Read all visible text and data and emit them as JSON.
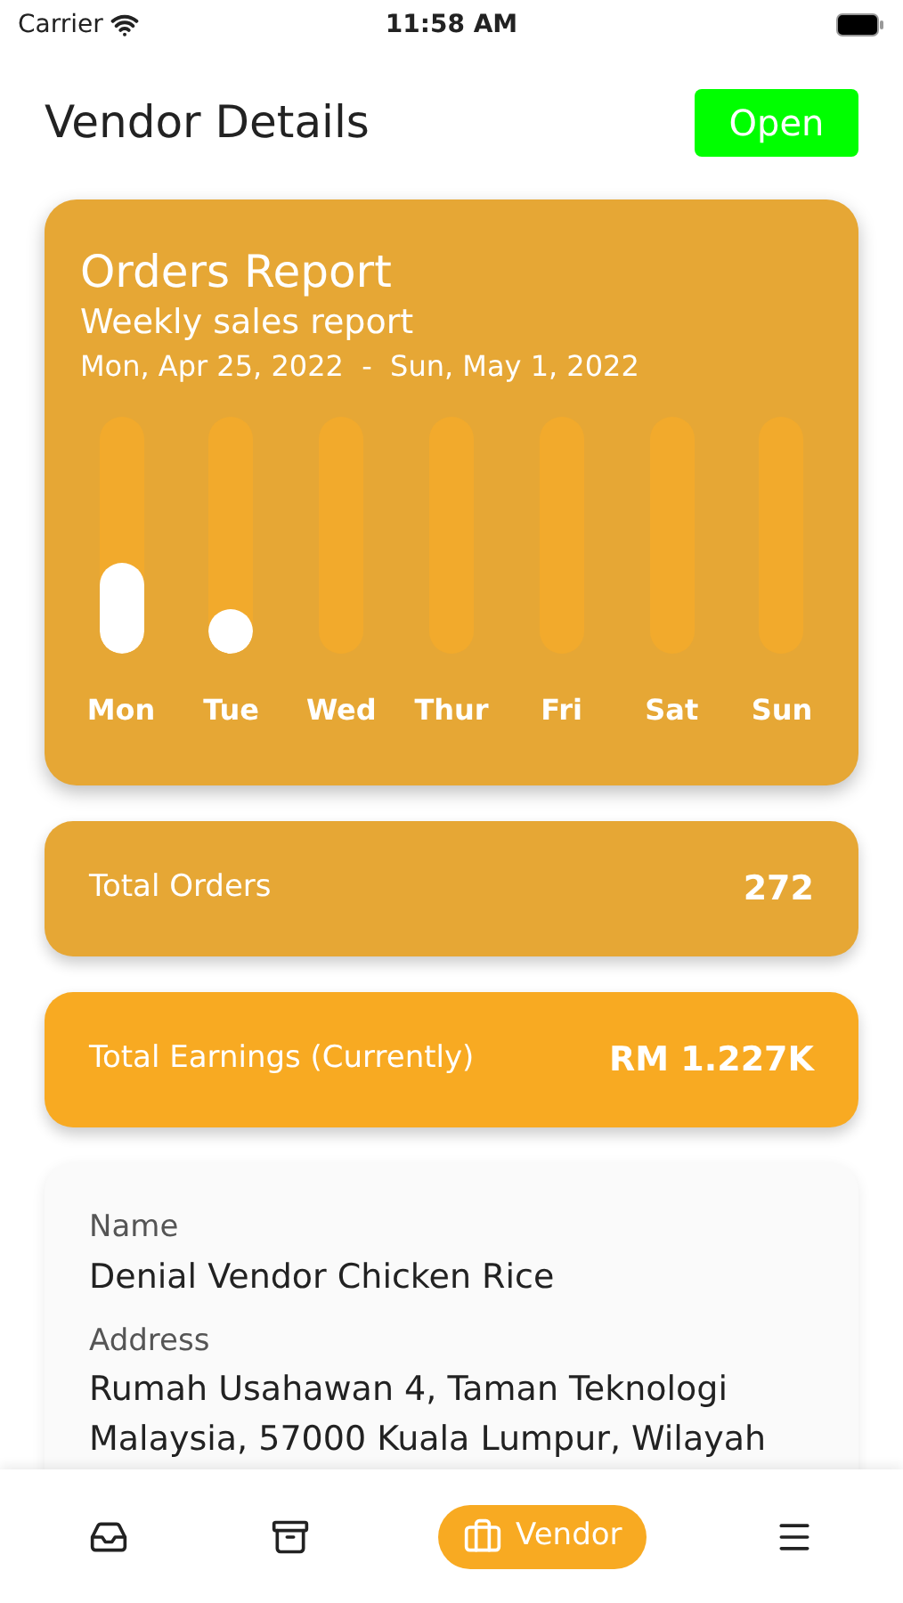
{
  "status_bar": {
    "carrier": "Carrier",
    "time": "11:58 AM"
  },
  "header": {
    "title": "Vendor Details",
    "status": "Open",
    "open": true
  },
  "report": {
    "title": "Orders Report",
    "subtitle": "Weekly sales report",
    "range": "Mon, Apr 25, 2022  -  Sun, May 1, 2022",
    "days": [
      {
        "label": "Mon",
        "level": 0.38
      },
      {
        "label": "Tue",
        "level": 0.18
      },
      {
        "label": "Wed"
      },
      {
        "label": "Thur"
      },
      {
        "label": "Fri"
      },
      {
        "label": "Sat"
      },
      {
        "label": "Sun"
      }
    ]
  },
  "stats": [
    {
      "label": "Total Orders",
      "value": "272",
      "kind": "muted"
    },
    {
      "label": "Total Earnings (Currently)",
      "value": "RM 1.227K",
      "kind": "bright"
    }
  ],
  "details": [
    {
      "label": "Name",
      "lines": [
        "Denial Vendor Chicken Rice"
      ]
    },
    {
      "label": "Address",
      "lines": [
        "Rumah Usahawan 4, Taman Teknologi",
        "Malaysia, 57000 Kuala Lumpur, Wilayah"
      ]
    }
  ],
  "tab_bar": [
    {
      "kind": "inbox",
      "selected": false
    },
    {
      "kind": "archive",
      "selected": false
    },
    {
      "kind": "briefcase",
      "label": "Vendor",
      "selected": true
    },
    {
      "kind": "menu",
      "selected": false
    }
  ]
}
